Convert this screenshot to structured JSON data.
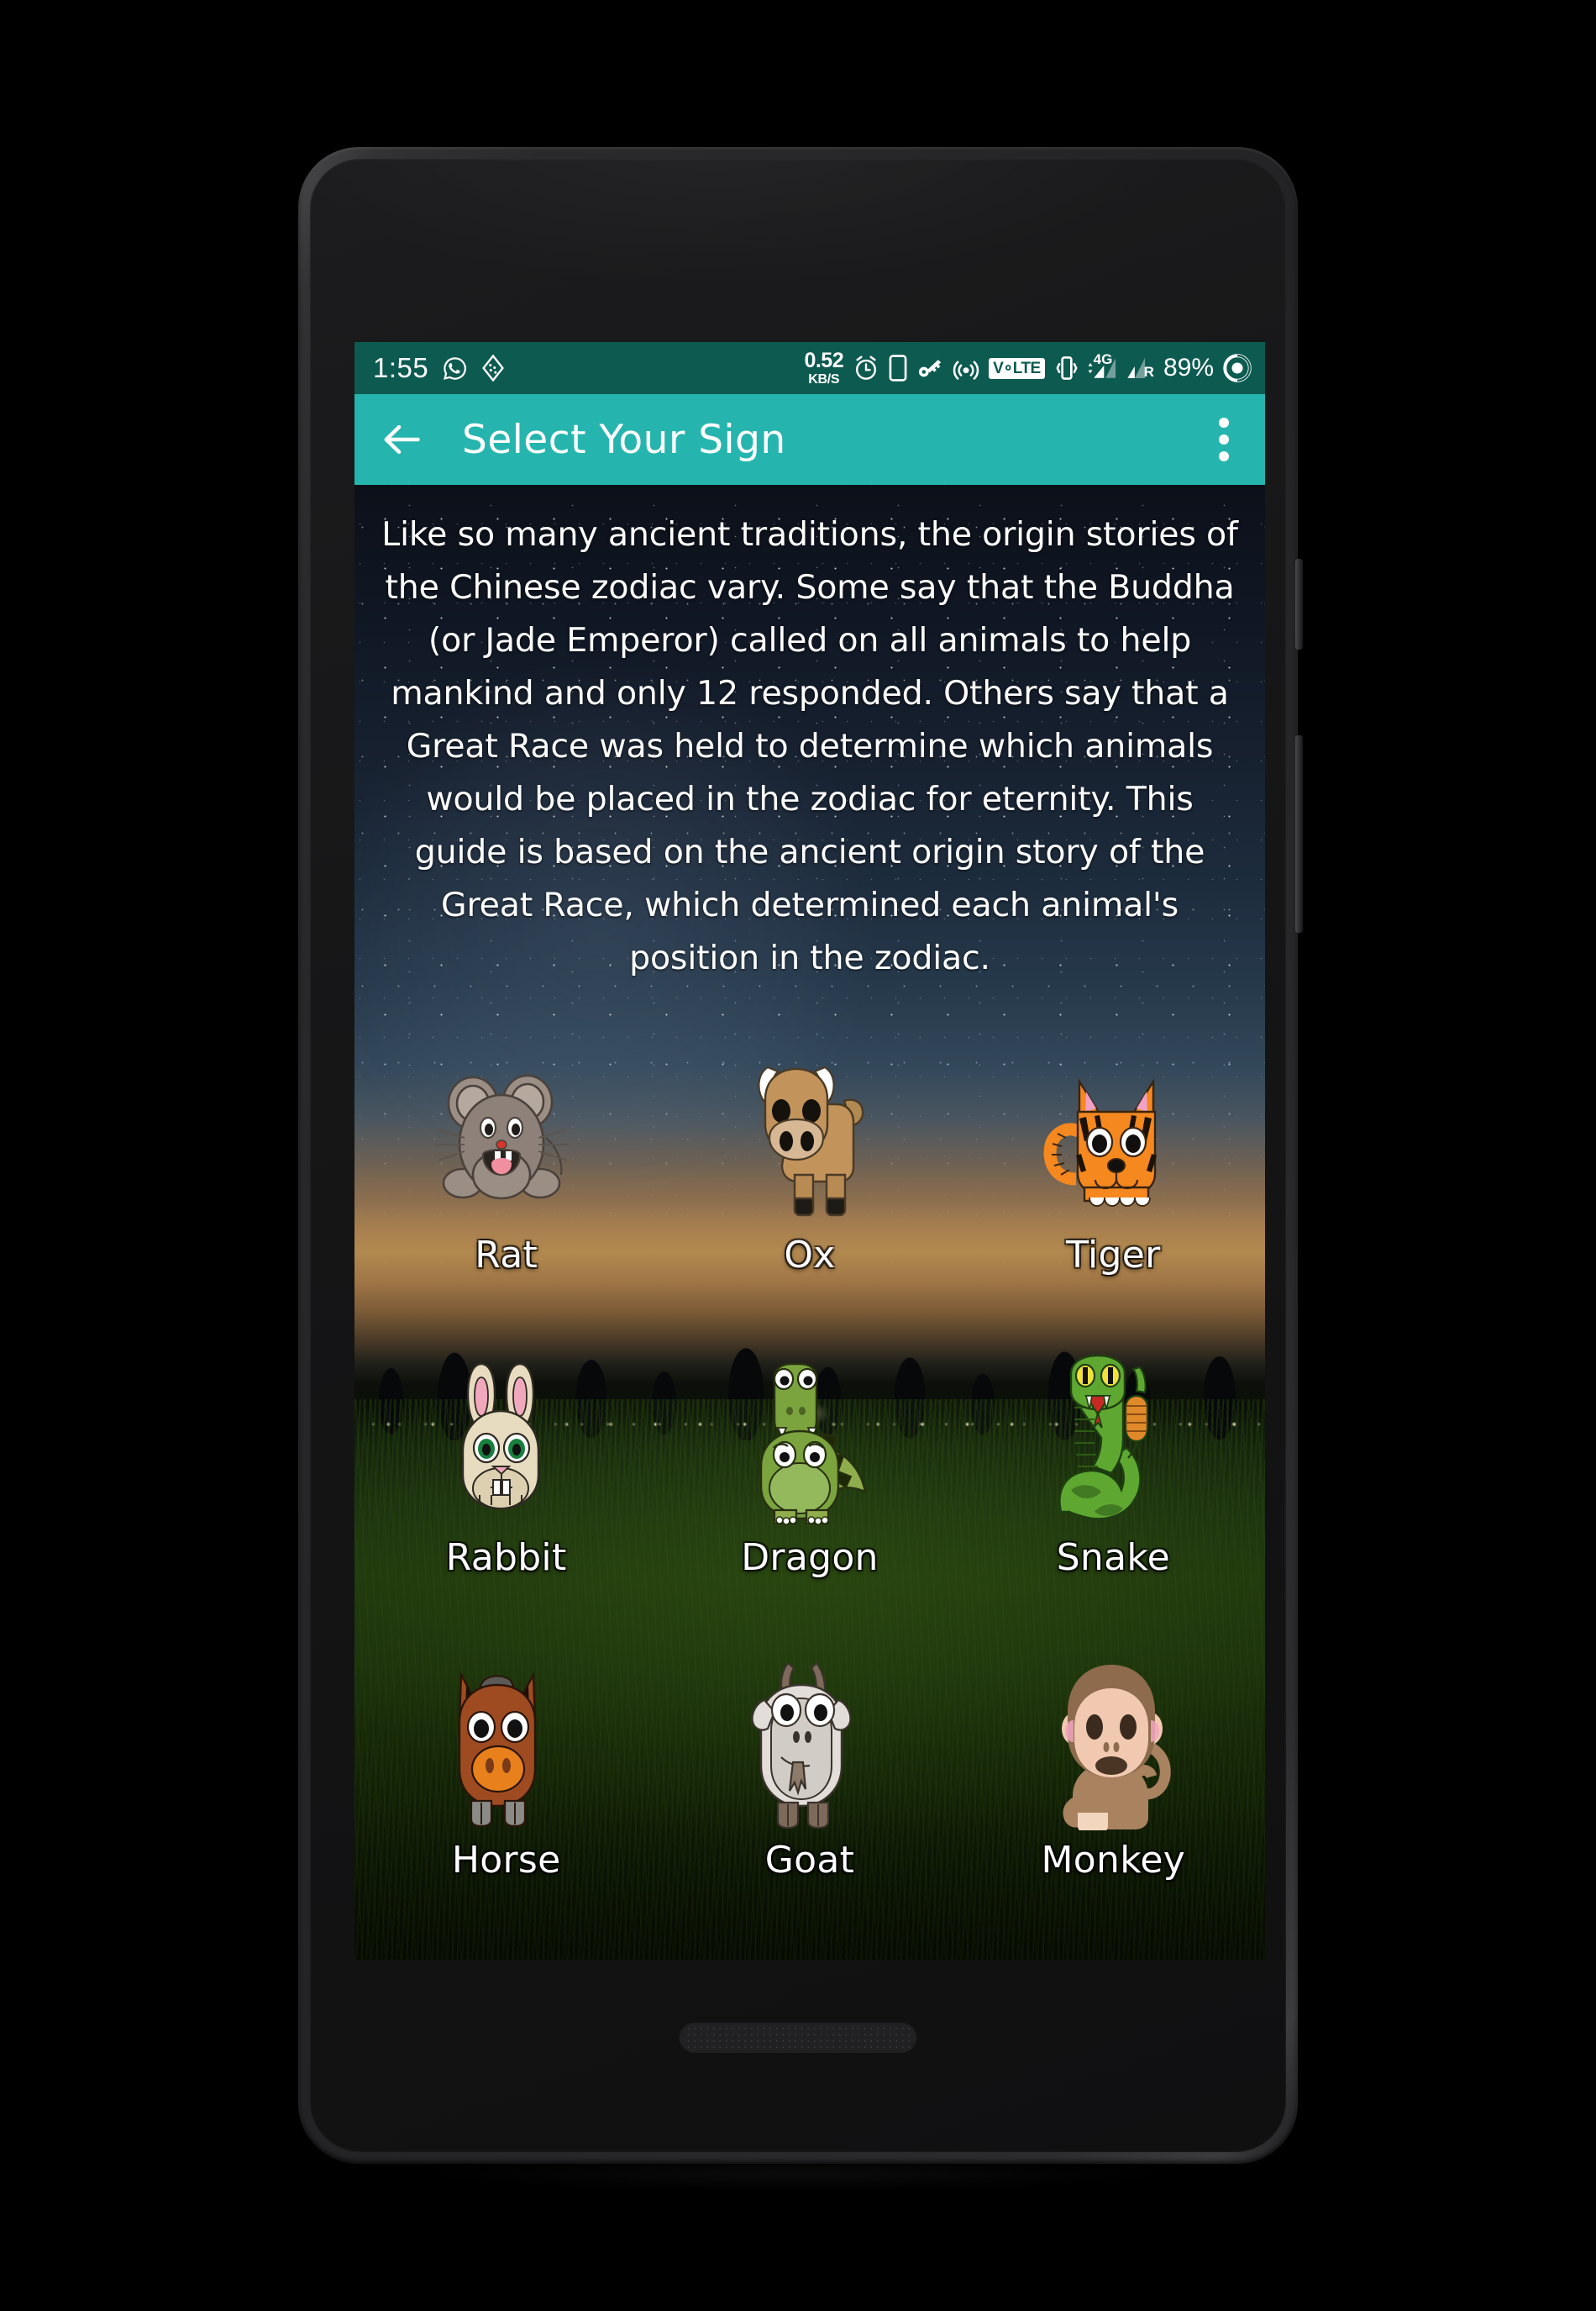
{
  "status_bar": {
    "time": "1:55",
    "whatsapp_icon": "whatsapp-icon",
    "dominos_icon": "dominos-pizza-icon",
    "data_speed_value": "0.52",
    "data_speed_unit": "KB/S",
    "alarm_icon": "alarm-clock-icon",
    "phone_icon": "phone-device-icon",
    "key_icon": "key-icon",
    "hotspot_icon": "hotspot-icon",
    "volte_label": "V∘LTE",
    "vibrate_icon": "vibrate-icon",
    "network_type": "4G",
    "roaming_label": "R",
    "battery_percent": "89%",
    "battery_icon": "battery-circle-icon",
    "background_color": "#0d5a51"
  },
  "app_bar": {
    "back_icon": "back-arrow-icon",
    "title": "Select Your Sign",
    "overflow_icon": "overflow-menu-icon",
    "background_color": "#26b5ae",
    "text_color": "#ffffff"
  },
  "content": {
    "intro_text": "Like so many ancient traditions, the origin stories of the Chinese zodiac vary. Some say that the Buddha (or Jade Emperor) called on all animals to help mankind and only 12 responded. Others say that a Great Race was held to determine which animals would be placed in the zodiac for eternity. This guide is based on the ancient origin story of the Great Race, which determined each animal's position in the zodiac.",
    "signs": [
      {
        "label": "Rat",
        "icon": "rat-icon",
        "color": "#8d8179"
      },
      {
        "label": "Ox",
        "icon": "ox-icon",
        "color": "#c2945c"
      },
      {
        "label": "Tiger",
        "icon": "tiger-icon",
        "color": "#f5881f"
      },
      {
        "label": "Rabbit",
        "icon": "rabbit-icon",
        "color": "#e8dcc0"
      },
      {
        "label": "Dragon",
        "icon": "dragon-icon",
        "color": "#7ba33e"
      },
      {
        "label": "Snake",
        "icon": "snake-icon",
        "color": "#5ea832"
      },
      {
        "label": "Horse",
        "icon": "horse-icon",
        "color": "#9e4b22"
      },
      {
        "label": "Goat",
        "icon": "goat-icon",
        "color": "#cfcbc6"
      },
      {
        "label": "Monkey",
        "icon": "monkey-icon",
        "color": "#a9825f"
      }
    ]
  },
  "device": {
    "camera_icon": "front-camera-icon",
    "earpiece_icon": "earpiece-speaker-icon",
    "bottom_speaker_icon": "bottom-speaker-icon",
    "power_button_icon": "power-button",
    "volume_button_icon": "volume-rocker-button"
  }
}
